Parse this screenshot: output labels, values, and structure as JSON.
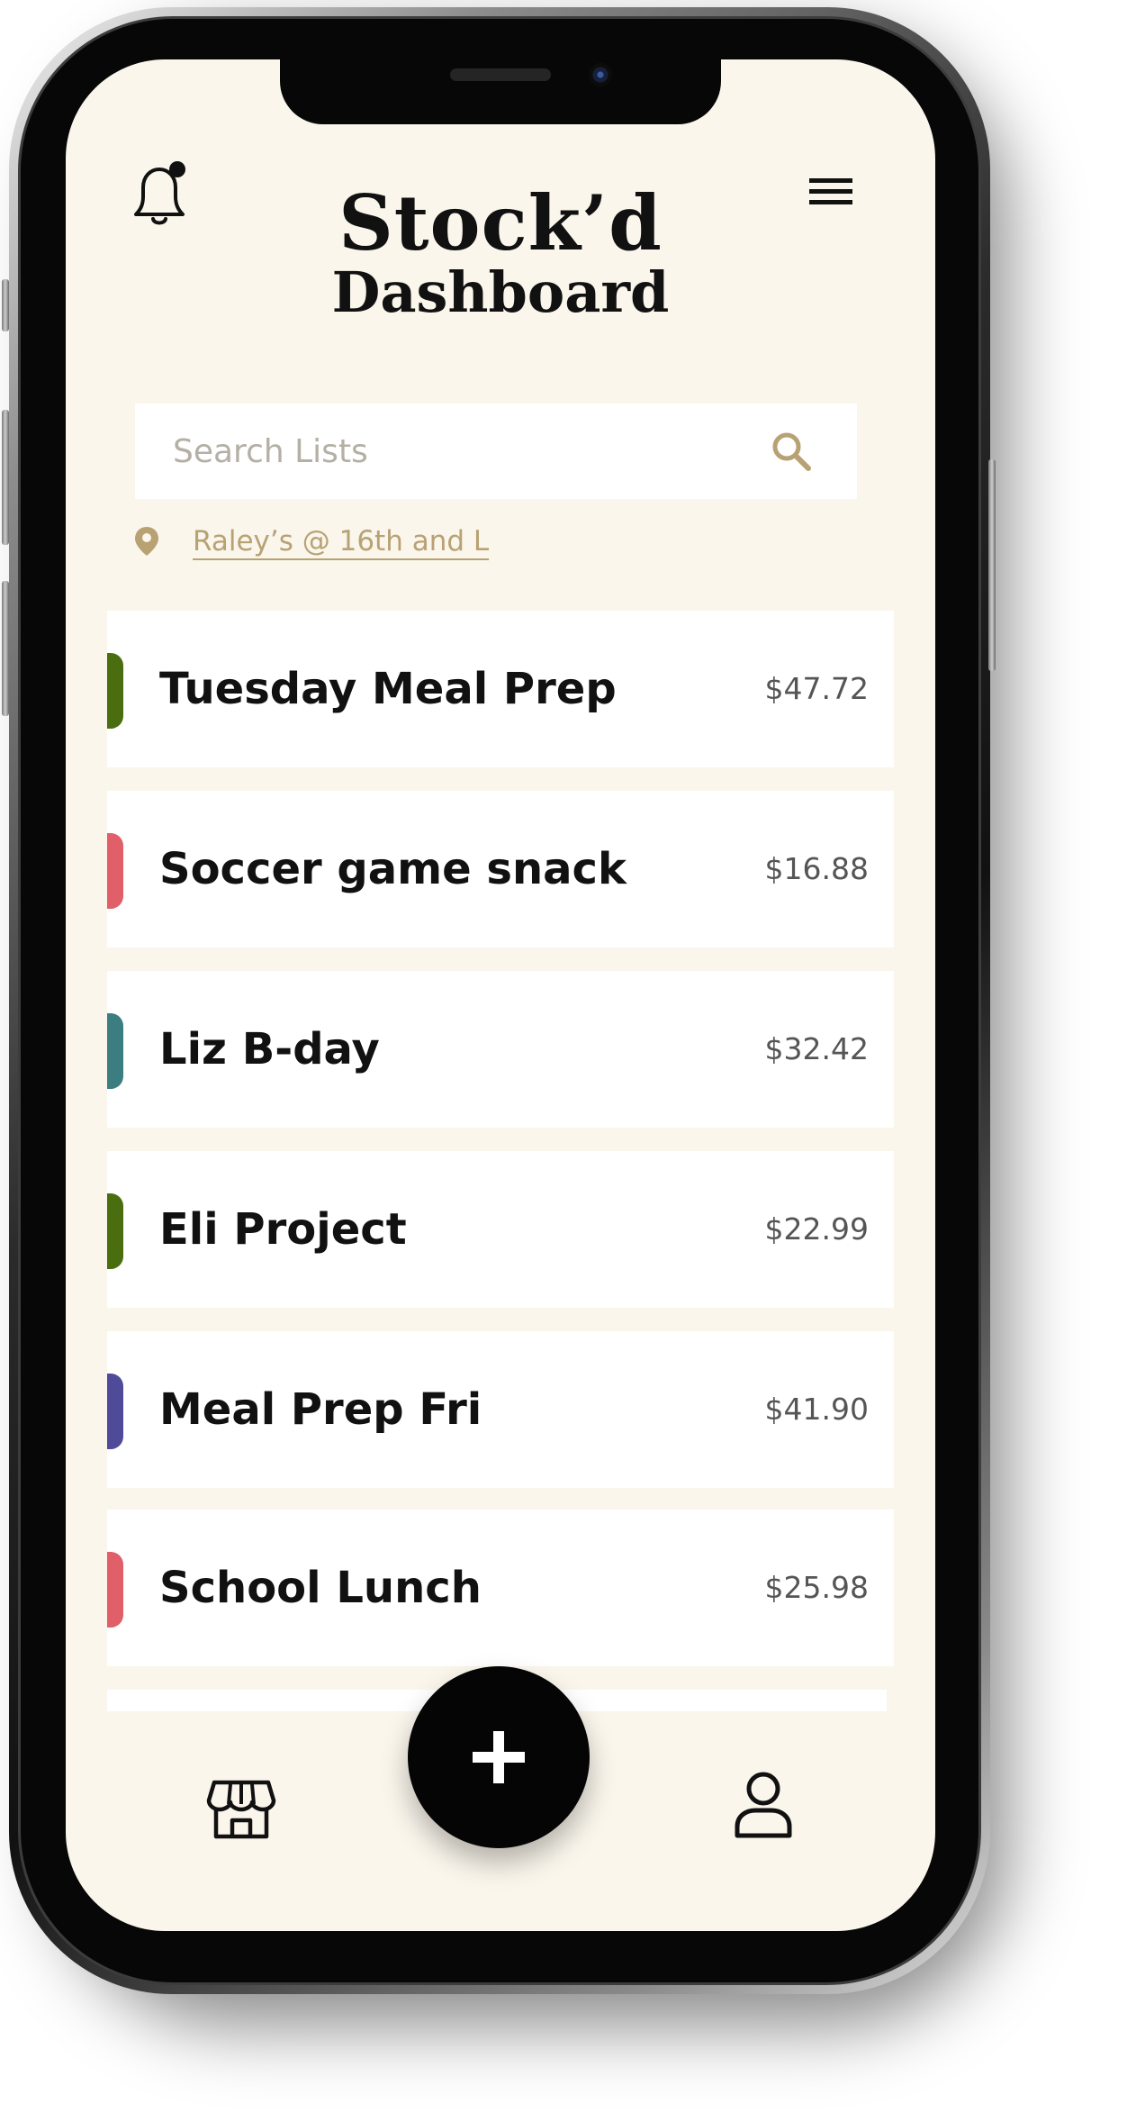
{
  "app": {
    "title_line1": "Stock’d",
    "title_line2": "Dashboard"
  },
  "header": {
    "notification_icon": "bell-with-badge-icon",
    "menu_icon": "hamburger-menu-icon"
  },
  "search": {
    "placeholder": "Search Lists",
    "value": "",
    "icon": "search-icon"
  },
  "location": {
    "icon": "map-pin-icon",
    "store_label": "Raley’s @ 16th and L"
  },
  "lists": [
    {
      "name": "Tuesday Meal Prep",
      "price": "$47.72",
      "color": "#4a6e0f"
    },
    {
      "name": "Soccer game snack",
      "price": "$16.88",
      "color": "#e05f68"
    },
    {
      "name": "Liz B-day",
      "price": "$32.42",
      "color": "#3c7d82"
    },
    {
      "name": "Eli Project",
      "price": "$22.99",
      "color": "#4a6e0f"
    },
    {
      "name": "Meal Prep Fri",
      "price": "$41.90",
      "color": "#4f4b98"
    },
    {
      "name": "School Lunch",
      "price": "$25.98",
      "color": "#e05f68"
    }
  ],
  "bottom_nav": {
    "store_icon": "storefront-icon",
    "add_icon": "plus-icon",
    "profile_icon": "user-profile-icon"
  },
  "colors": {
    "background": "#faf6ec",
    "accent_gold": "#b8a274",
    "text": "#111111"
  }
}
